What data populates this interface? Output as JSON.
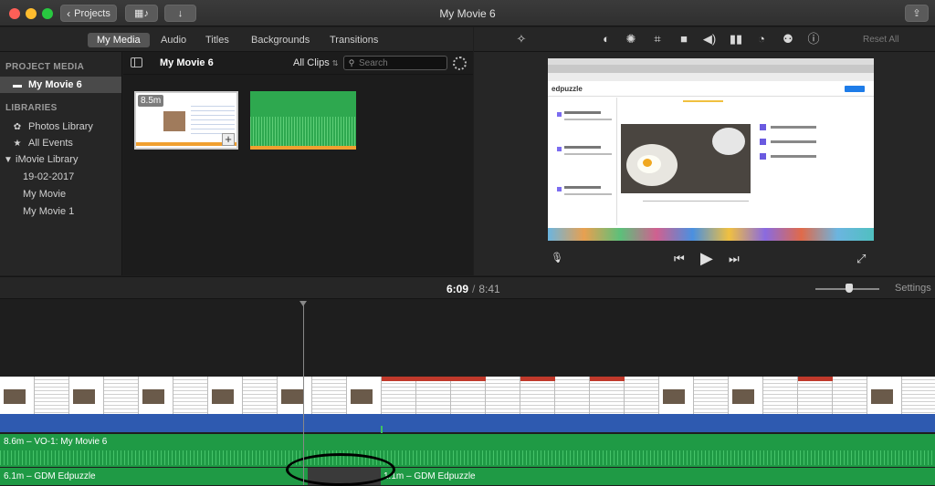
{
  "window": {
    "title": "My Movie 6",
    "projects_label": "Projects"
  },
  "tabs": [
    {
      "label": "My Media",
      "active": true
    },
    {
      "label": "Audio"
    },
    {
      "label": "Titles"
    },
    {
      "label": "Backgrounds"
    },
    {
      "label": "Transitions"
    }
  ],
  "sidebar": {
    "project_media_heading": "PROJECT MEDIA",
    "project_item": "My Movie 6",
    "libraries_heading": "LIBRARIES",
    "items": [
      {
        "label": "Photos Library",
        "icon": "photos-icon"
      },
      {
        "label": "All Events",
        "icon": "star-icon"
      },
      {
        "label": "iMovie Library",
        "icon": "disclosure-triangle-icon"
      },
      {
        "label": "19-02-2017"
      },
      {
        "label": "My Movie"
      },
      {
        "label": "My Movie 1"
      }
    ]
  },
  "browser": {
    "event_title": "My Movie 6",
    "filter": "All Clips",
    "search_placeholder": "Search",
    "clips": [
      {
        "duration": "8.5m"
      }
    ]
  },
  "viewer": {
    "reset_all": "Reset All",
    "preview_logo": "edpuzzle"
  },
  "timeline": {
    "current_time": "6:09",
    "separator": "/",
    "total_time": "8:41",
    "settings_label": "Settings",
    "zoom_level": 0.47,
    "tracks": [
      {
        "label": "8.6m – VO-1: My Movie 6"
      },
      {
        "label": "6.1m – GDM Edpuzzle"
      },
      {
        "label": "1.1m – GDM Edpuzzle"
      }
    ]
  },
  "colors": {
    "voiceover_track": "#1f9a45",
    "video_track": "#2e5ab0",
    "clip_bar": "#f0a030"
  }
}
